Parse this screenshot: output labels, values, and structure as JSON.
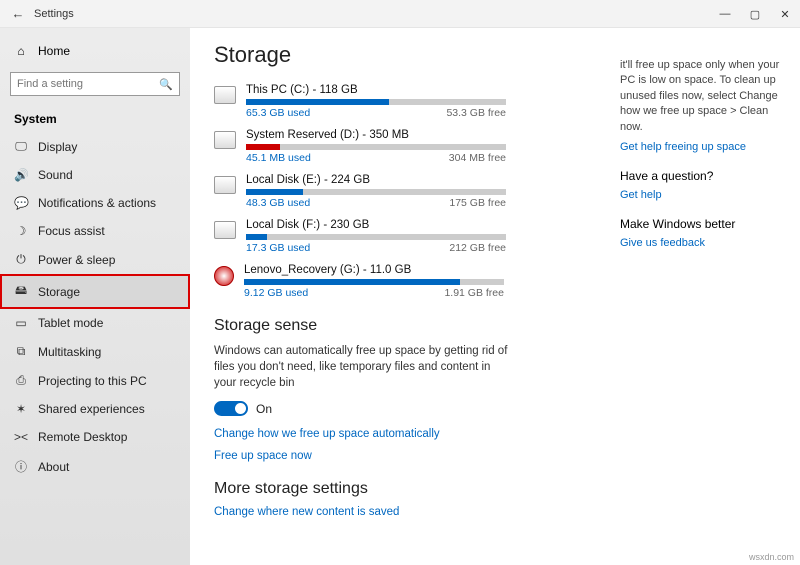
{
  "titlebar": {
    "back": "←",
    "title": "Settings"
  },
  "window_buttons": {
    "min": "—",
    "max": "▢",
    "close": "✕"
  },
  "sidebar": {
    "home": {
      "icon": "⌂",
      "label": "Home"
    },
    "search_placeholder": "Find a setting",
    "group": "System",
    "items": [
      {
        "icon": "🖵",
        "label": "Display"
      },
      {
        "icon": "🔊",
        "label": "Sound"
      },
      {
        "icon": "💬",
        "label": "Notifications & actions"
      },
      {
        "icon": "☽",
        "label": "Focus assist"
      },
      {
        "icon": "⏻",
        "label": "Power & sleep"
      },
      {
        "icon": "🖴",
        "label": "Storage",
        "selected": true
      },
      {
        "icon": "▭",
        "label": "Tablet mode"
      },
      {
        "icon": "⧉",
        "label": "Multitasking"
      },
      {
        "icon": "⎙",
        "label": "Projecting to this PC"
      },
      {
        "icon": "✶",
        "label": "Shared experiences"
      },
      {
        "icon": "><",
        "label": "Remote Desktop"
      },
      {
        "icon": "ⓘ",
        "label": "About"
      }
    ]
  },
  "page": {
    "heading": "Storage",
    "drives": [
      {
        "title": "This PC (C:) - 118 GB",
        "used": "65.3 GB used",
        "free": "53.3 GB free",
        "pct": 55,
        "color": "blue",
        "icon": "disk"
      },
      {
        "title": "System Reserved (D:) - 350 MB",
        "used": "45.1 MB used",
        "free": "304 MB free",
        "pct": 13,
        "color": "red",
        "icon": "disk"
      },
      {
        "title": "Local Disk (E:) - 224 GB",
        "used": "48.3 GB used",
        "free": "175 GB free",
        "pct": 22,
        "color": "blue",
        "icon": "disk"
      },
      {
        "title": "Local Disk (F:) - 230 GB",
        "used": "17.3 GB used",
        "free": "212 GB free",
        "pct": 8,
        "color": "blue",
        "icon": "disk"
      },
      {
        "title": "Lenovo_Recovery (G:) - 11.0 GB",
        "used": "9.12 GB used",
        "free": "1.91 GB free",
        "pct": 83,
        "color": "blue",
        "icon": "lenovo"
      }
    ],
    "sense_heading": "Storage sense",
    "sense_desc": "Windows can automatically free up space by getting rid of files you don't need, like temporary files and content in your recycle bin",
    "toggle_label": "On",
    "link_change": "Change how we free up space automatically",
    "link_freeup": "Free up space now",
    "more_heading": "More storage settings",
    "link_more": "Change where new content is saved"
  },
  "right": {
    "tip": "it'll free up space only when your PC is low on space. To clean up unused files now, select Change how we free up space > Clean now.",
    "tip_link": "Get help freeing up space",
    "q_heading": "Have a question?",
    "q_link": "Get help",
    "fb_heading": "Make Windows better",
    "fb_link": "Give us feedback"
  },
  "watermark": "wsxdn.com"
}
